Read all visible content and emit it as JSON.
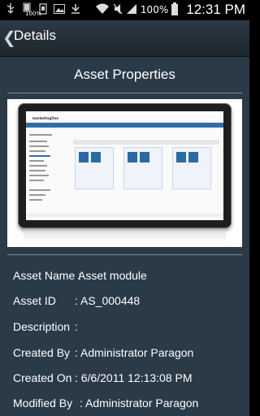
{
  "status_bar": {
    "battery_small_pct": "100%",
    "battery_pct": "100%",
    "time": "12:31 PM",
    "icons": [
      "usb-icon",
      "battery-small-icon",
      "sd-card-icon",
      "image-icon",
      "download-icon",
      "wifi-icon",
      "mute-icon",
      "signal-icon",
      "battery-icon"
    ]
  },
  "action_bar": {
    "back_glyph": "❮",
    "title": "Details"
  },
  "page": {
    "heading": "Asset Properties"
  },
  "preview": {
    "logo_text": "marketingOne"
  },
  "properties": [
    {
      "label": "Asset Name :",
      "value": "Asset module"
    },
    {
      "label": "Asset ID",
      "value": ": AS_000448"
    },
    {
      "label": "Description",
      "value": ":"
    },
    {
      "label": "Created By",
      "value": ": Administrator  Paragon"
    },
    {
      "label": "Created On",
      "value": ": 6/6/2011 12:13:08 PM"
    },
    {
      "label": "Modified By",
      "value": ": Administrator  Paragon"
    }
  ],
  "colors": {
    "content_bg": "#2a3a47",
    "action_bar": "#2d3a45",
    "separator": "#7c8b96"
  }
}
